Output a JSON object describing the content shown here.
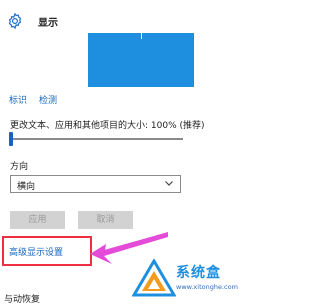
{
  "header": {
    "title": "显示",
    "icon": "gear-icon"
  },
  "links": {
    "identify": "标识",
    "detect": "检测"
  },
  "scale": {
    "label": "更改文本、应用和其他项目的大小: 100% (推荐)",
    "value_percent": 100
  },
  "orientation": {
    "label": "方向",
    "selected": "横向"
  },
  "buttons": {
    "apply": "应用",
    "cancel": "取消"
  },
  "advanced": {
    "label": "高级显示设置"
  },
  "bottom": {
    "partial_text": "与动恢复"
  },
  "watermark": {
    "brand": "系统盒",
    "url": "www.xitonghe.com"
  },
  "colors": {
    "accent": "#1565c0",
    "monitor": "#1e8fdf",
    "highlight": "#ef2f3f",
    "arrow": "#e34bd8",
    "disabled_button": "#d2d2d2"
  }
}
